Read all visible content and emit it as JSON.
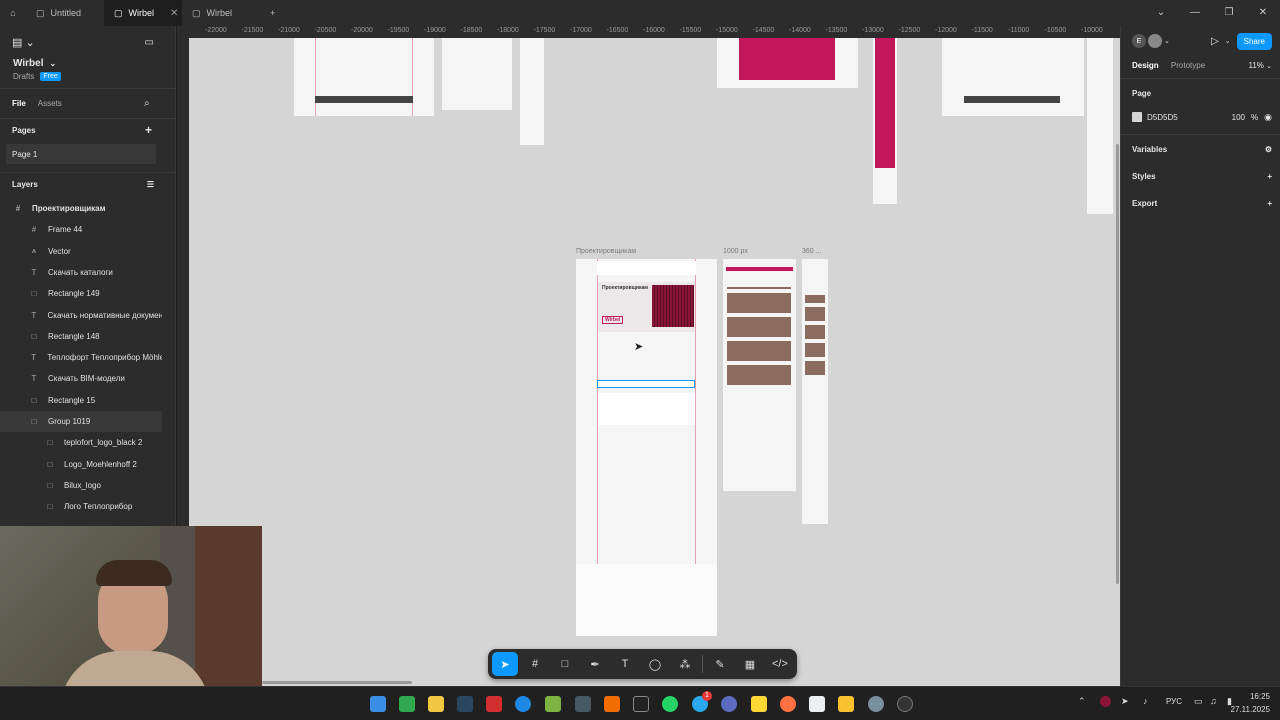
{
  "tabs": [
    {
      "label": "Untitled",
      "active": false
    },
    {
      "label": "Wirbel",
      "active": true
    },
    {
      "label": "Wirbel",
      "active": false
    }
  ],
  "file": {
    "name": "Wirbel",
    "location": "Drafts",
    "plan": "Free"
  },
  "left_tabs": {
    "file": "File",
    "assets": "Assets"
  },
  "pages": {
    "title": "Pages",
    "items": [
      "Page 1"
    ]
  },
  "layers": {
    "title": "Layers",
    "items": [
      {
        "name": "Проектировщикам",
        "type": "frame",
        "indent": 0
      },
      {
        "name": "Frame 44",
        "type": "frame",
        "indent": 1
      },
      {
        "name": "Vector",
        "type": "vector",
        "indent": 1
      },
      {
        "name": "Скачать каталоги",
        "type": "text",
        "indent": 1
      },
      {
        "name": "Rectangle 149",
        "type": "rect",
        "indent": 1
      },
      {
        "name": "Скачать нормативные документ",
        "type": "text",
        "indent": 1
      },
      {
        "name": "Rectangle 148",
        "type": "rect",
        "indent": 1
      },
      {
        "name": "Теплофорт Теплоприбор Möhlen",
        "type": "text",
        "indent": 1
      },
      {
        "name": "Скачать BIM-модели",
        "type": "text",
        "indent": 1
      },
      {
        "name": "Rectangle 15",
        "type": "rect",
        "indent": 1
      },
      {
        "name": "Group 1019",
        "type": "group",
        "indent": 1
      },
      {
        "name": "teplofort_logo_black 2",
        "type": "rect",
        "indent": 2
      },
      {
        "name": "Logo_Moehlenhoff 2",
        "type": "rect",
        "indent": 2
      },
      {
        "name": "Bilux_logo",
        "type": "rect",
        "indent": 2
      },
      {
        "name": "Лого Теплоприбор",
        "type": "rect",
        "indent": 2
      }
    ]
  },
  "ruler_ticks": [
    "-22000",
    "-21500",
    "-21000",
    "-20500",
    "-20000",
    "-19500",
    "-19000",
    "-18500",
    "-18000",
    "-17500",
    "-17000",
    "-16500",
    "-16000",
    "-15500",
    "-15000",
    "-14500",
    "-14000",
    "-13500",
    "-13000",
    "-12500",
    "-12000",
    "-11500",
    "-11000",
    "-10500",
    "-10000"
  ],
  "canvas_labels": {
    "frame_main": "Проектировщикам",
    "frame_1000": "1000 px",
    "frame_360": "360 ..."
  },
  "frame_content": {
    "hero_title": "Проектировщикам",
    "logo": "Wirbel"
  },
  "right_panel": {
    "avatar_letter": "E",
    "share_label": "Share",
    "tab_design": "Design",
    "tab_prototype": "Prototype",
    "zoom": "11%",
    "page_section": "Page",
    "page_color": "D5D5D5",
    "page_opacity": "100",
    "percent": "%",
    "variables": "Variables",
    "styles": "Styles",
    "export": "Export"
  },
  "taskbar": {
    "lang": "РУС",
    "time": "16:25",
    "date": "27.11.2025",
    "badge": "1"
  },
  "colors": {
    "accent": "#0d99ff",
    "canvas": "#d5d5d5",
    "brand": "#c2185b"
  }
}
